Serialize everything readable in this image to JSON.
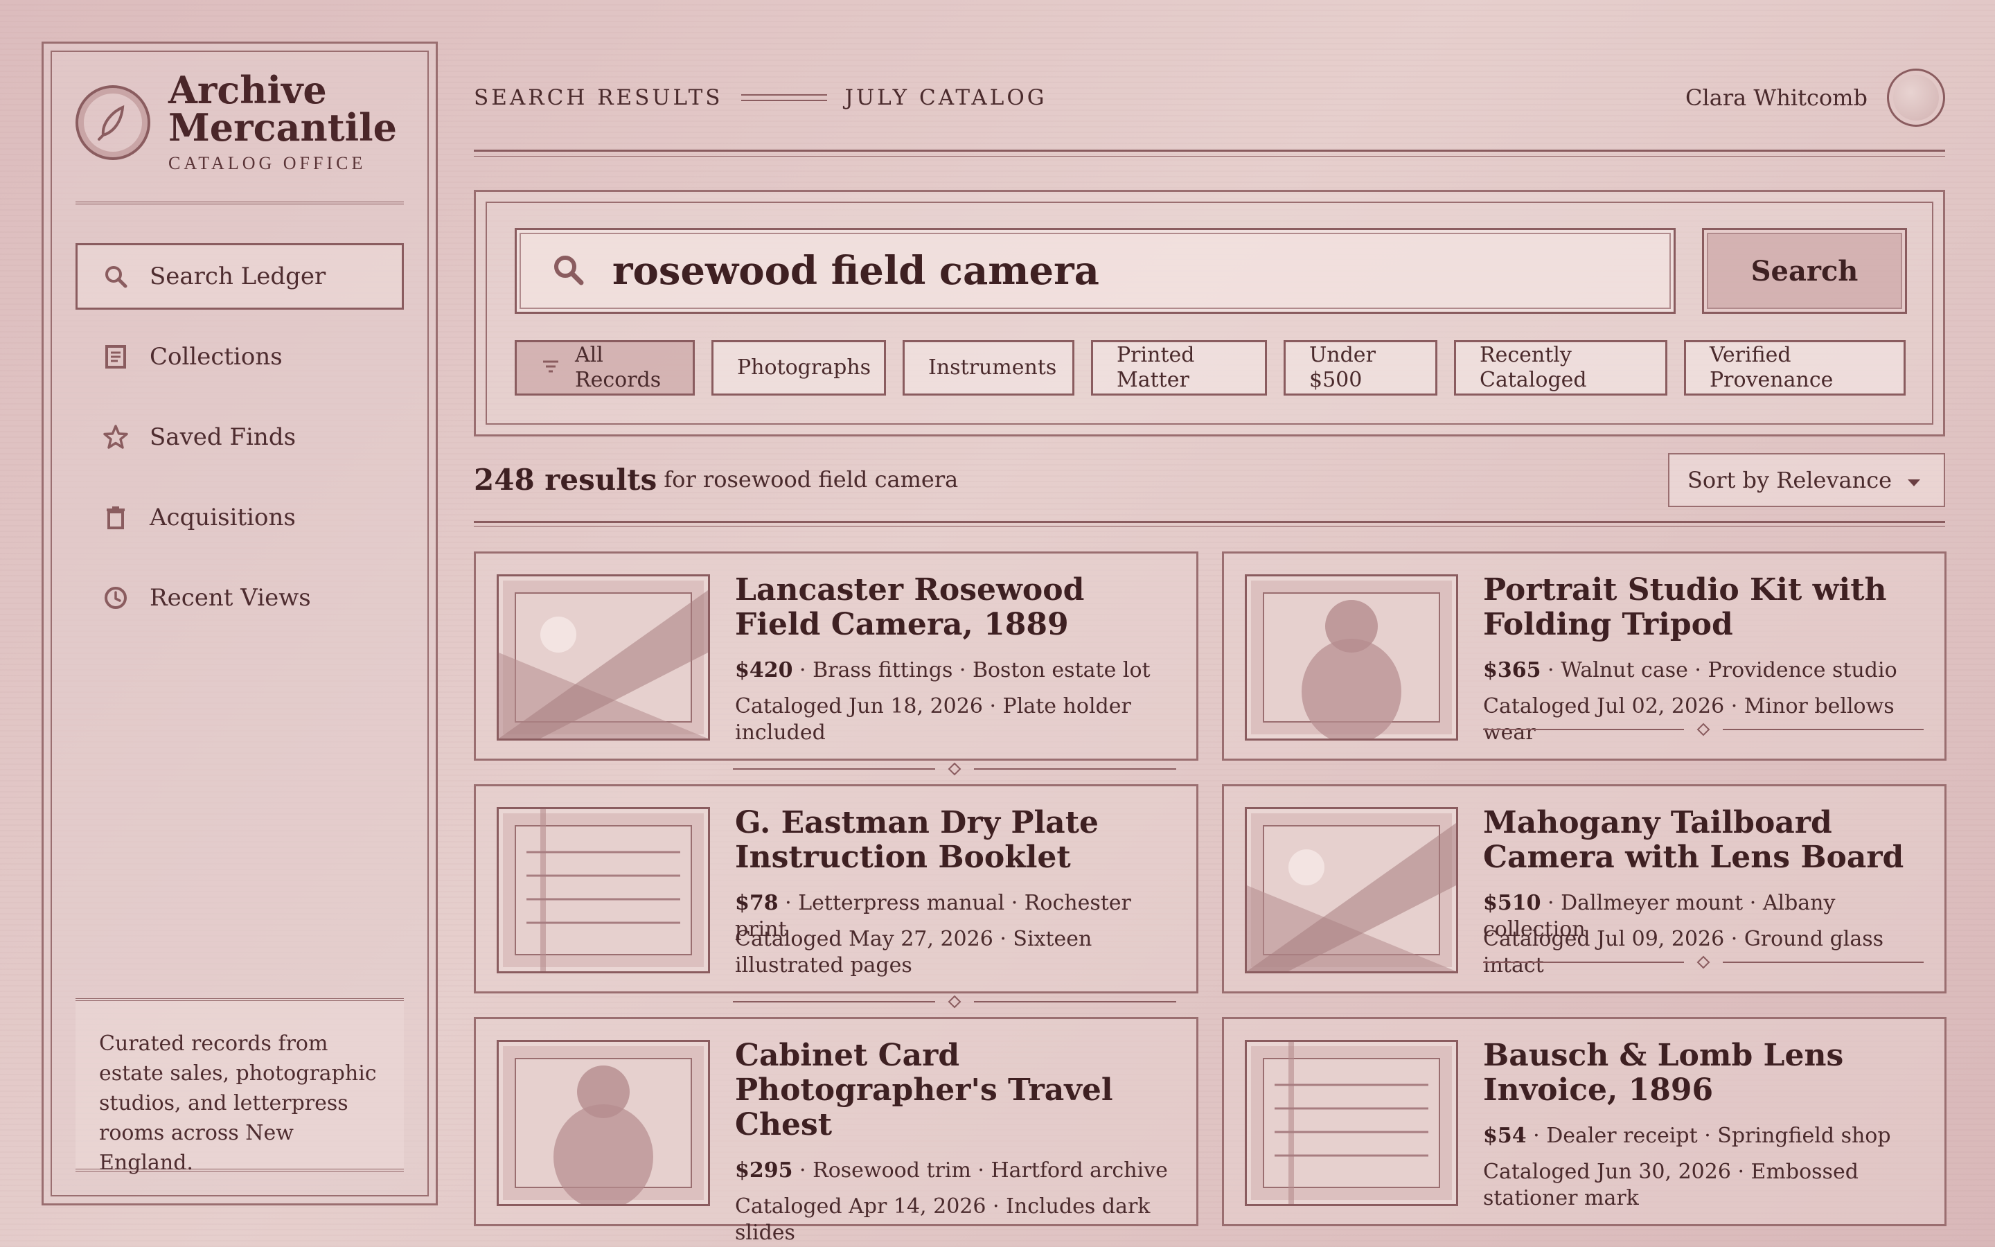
{
  "brand": {
    "title_line1": "Archive",
    "title_line2": "Mercantile",
    "subtitle": "CATALOG OFFICE"
  },
  "sidebar": {
    "items": [
      {
        "label": "Search Ledger",
        "icon": "search-icon",
        "active": true
      },
      {
        "label": "Collections",
        "icon": "ledger-icon",
        "active": false
      },
      {
        "label": "Saved Finds",
        "icon": "star-icon",
        "active": false
      },
      {
        "label": "Acquisitions",
        "icon": "trash-can-icon",
        "active": false
      },
      {
        "label": "Recent Views",
        "icon": "clock-icon",
        "active": false
      }
    ],
    "footer": "Curated records from estate sales, photographic studios, and letterpress rooms across New England."
  },
  "header": {
    "crumb_1": "SEARCH RESULTS",
    "crumb_2": "JULY CATALOG",
    "user_name": "Clara Whitcomb"
  },
  "search": {
    "query": "rosewood field camera",
    "button_label": "Search",
    "filters": [
      {
        "label_1": "All",
        "label_2": "Records",
        "active": true
      },
      {
        "label_1": "Photographs",
        "label_2": ""
      },
      {
        "label_1": "Instruments",
        "label_2": ""
      },
      {
        "label_1": "Printed",
        "label_2": "Matter"
      },
      {
        "label_1": "Under",
        "label_2": "$500"
      },
      {
        "label_1": "Recently",
        "label_2": "Cataloged"
      },
      {
        "label_1": "Verified",
        "label_2": "Provenance"
      }
    ]
  },
  "results": {
    "count": "248 results",
    "for_text": "for rosewood field camera",
    "sort_label": "Sort by Relevance"
  },
  "cards": [
    {
      "title": "Lancaster Rosewood Field Camera, 1889",
      "price": "$420",
      "meta": " · Brass fittings · Boston estate lot",
      "note": "Cataloged Jun 18, 2026 · Plate holder included",
      "thumb": "landscape"
    },
    {
      "title": "Portrait Studio Kit with Folding Tripod",
      "price": "$365",
      "meta": " · Walnut case · Providence studio",
      "note": "Cataloged Jul 02, 2026 · Minor bellows wear",
      "thumb": "portrait"
    },
    {
      "title": "G. Eastman Dry Plate Instruction Booklet",
      "price": "$78",
      "meta": " · Letterpress manual · Rochester print",
      "note": "Cataloged May 27, 2026 · Sixteen illustrated pages",
      "thumb": "document"
    },
    {
      "title": "Mahogany Tailboard Camera with Lens Board",
      "price": "$510",
      "meta": " · Dallmeyer mount · Albany collection",
      "note": "Cataloged Jul 09, 2026 · Ground glass intact",
      "thumb": "landscape"
    },
    {
      "title": "Cabinet Card Photographer's Travel Chest",
      "price": "$295",
      "meta": " · Rosewood trim · Hartford archive",
      "note": "Cataloged Apr 14, 2026 · Includes dark slides",
      "thumb": "portrait"
    },
    {
      "title": "Bausch & Lomb Lens Invoice, 1896",
      "price": "$54",
      "meta": " · Dealer receipt · Springfield shop",
      "note": "Cataloged Jun 30, 2026 · Embossed stationer mark",
      "thumb": "document"
    }
  ]
}
